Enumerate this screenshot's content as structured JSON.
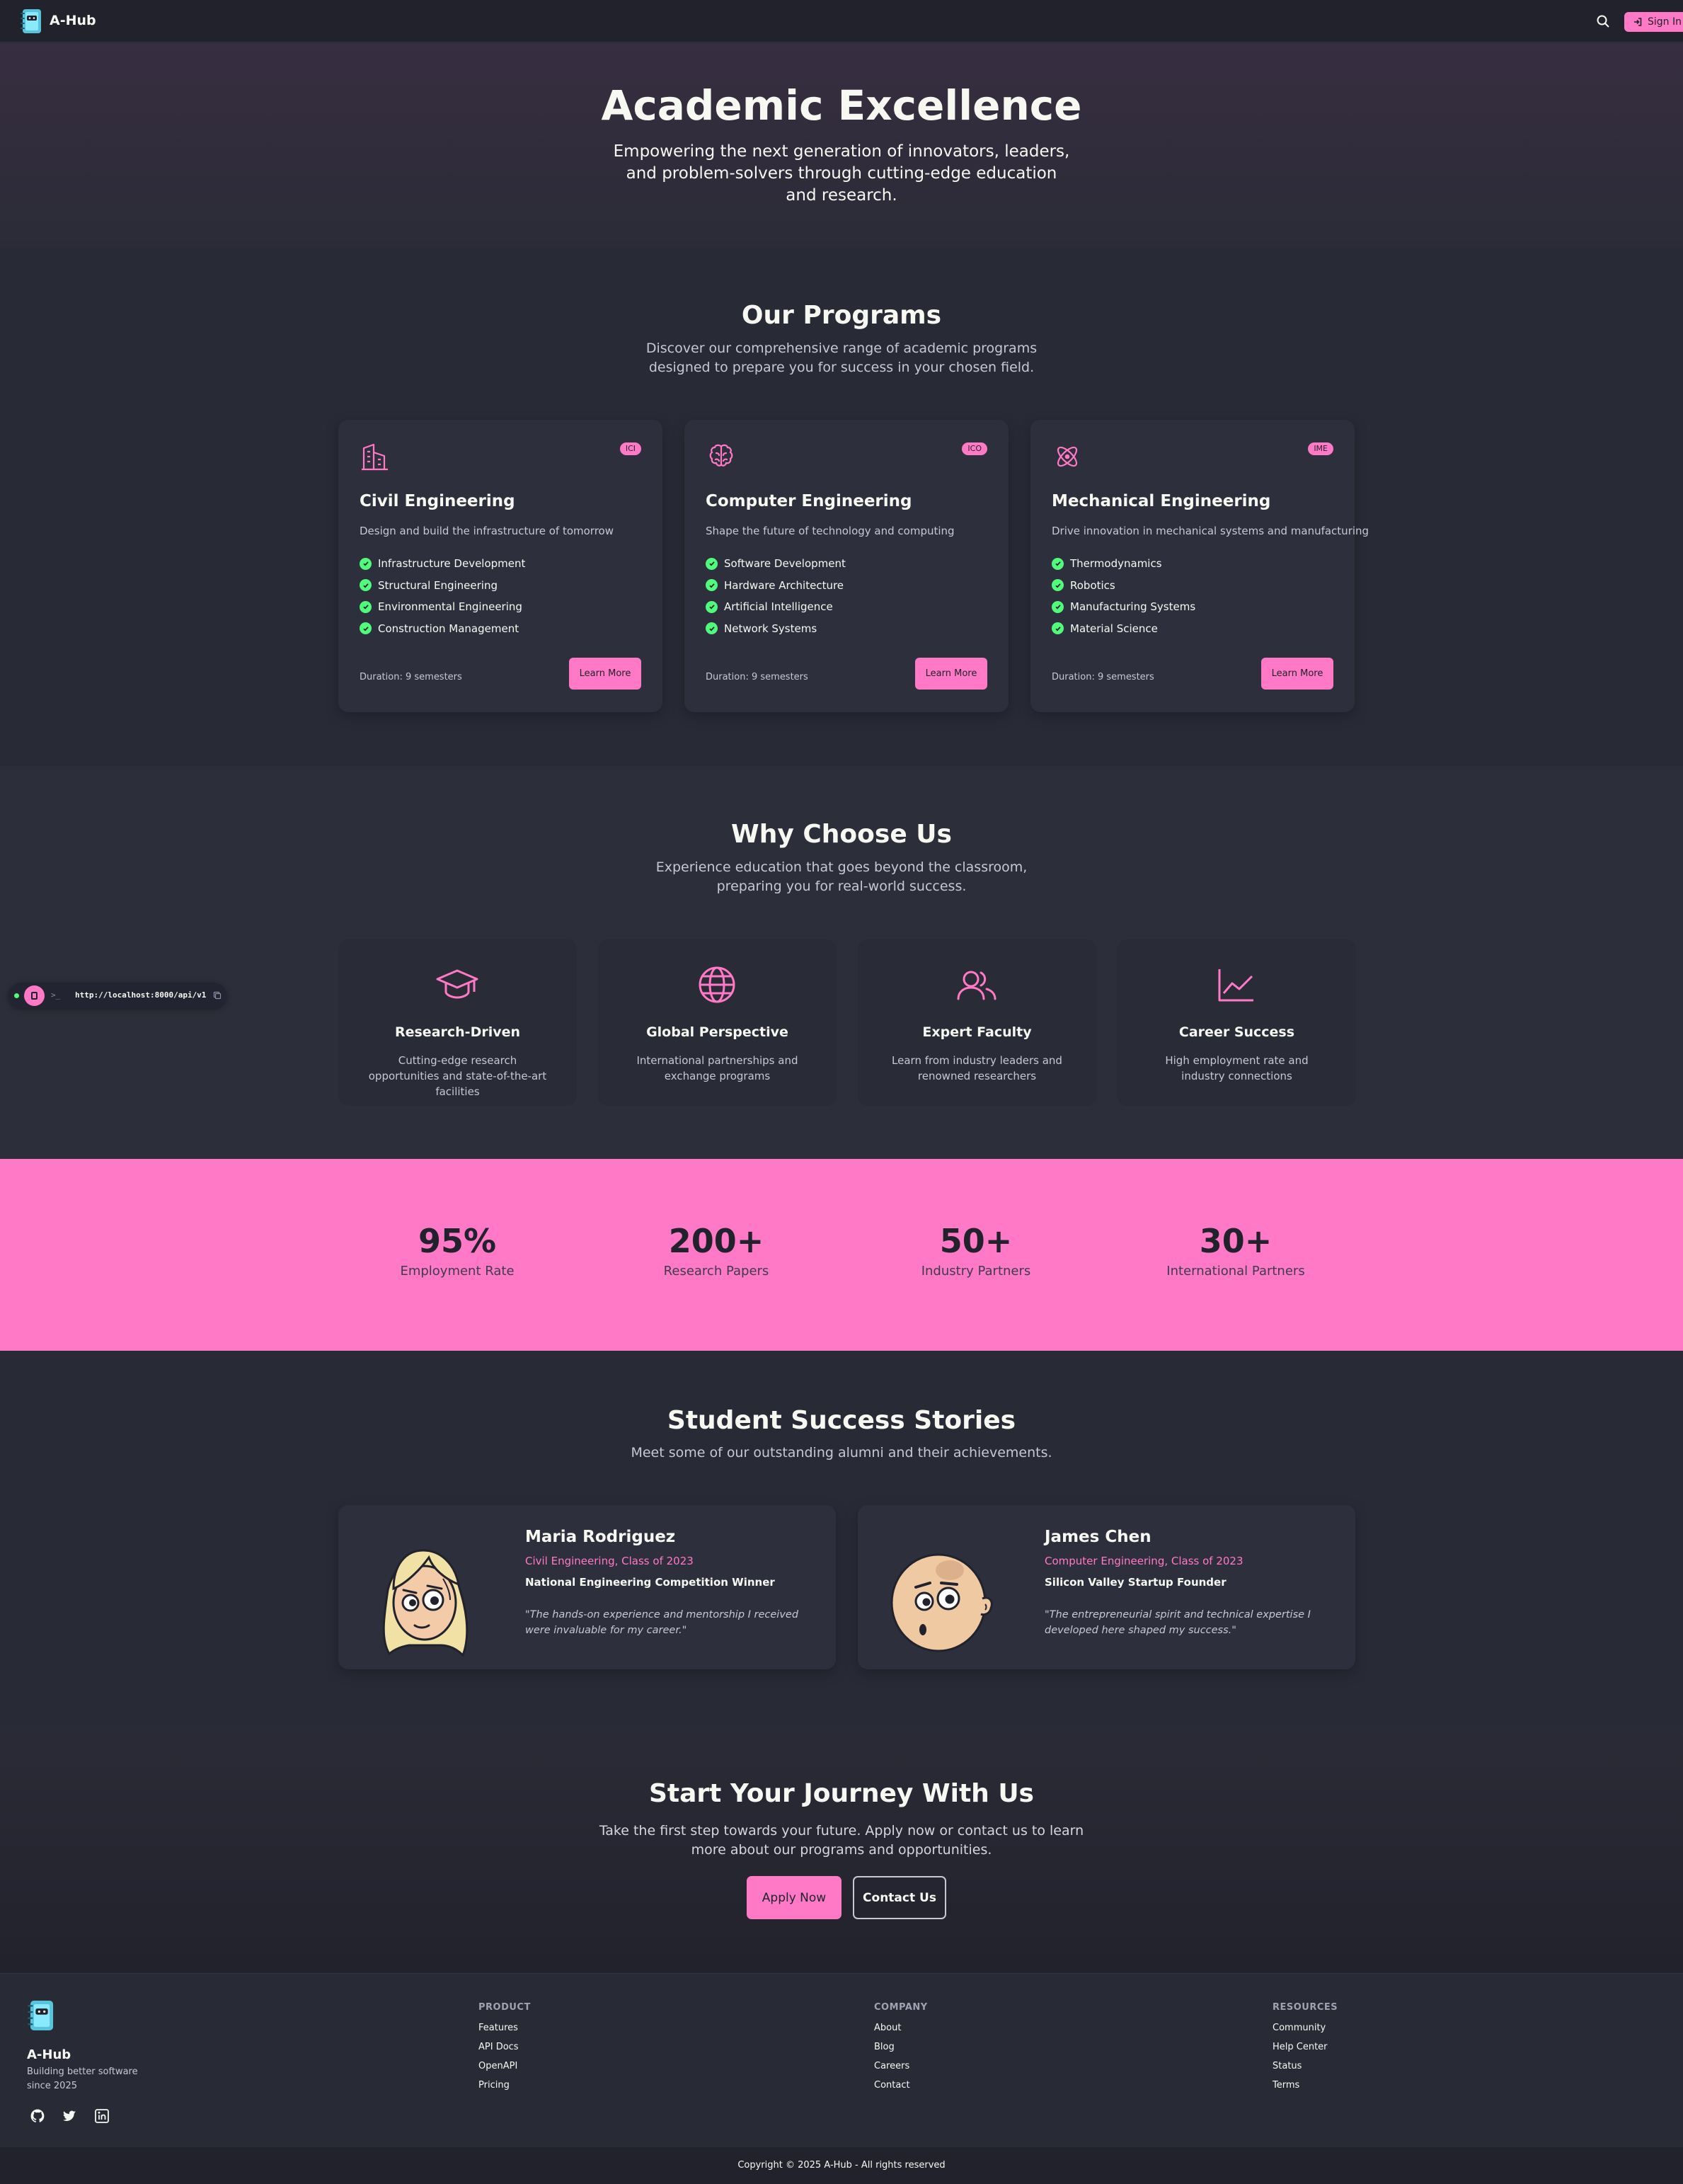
{
  "nav": {
    "brand": "A-Hub",
    "signin_label": "Sign In"
  },
  "hero": {
    "title": "Academic Excellence",
    "subtitle": "Empowering the next generation of innovators, leaders, and problem-solvers through cutting-edge education and research."
  },
  "programs": {
    "title": "Our Programs",
    "subtitle": "Discover our comprehensive range of academic programs designed to prepare you for success in your chosen field.",
    "cards": [
      {
        "icon": "building-icon",
        "badge": "ICI",
        "title": "Civil Engineering",
        "desc": "Design and build the infrastructure of tomorrow",
        "features": [
          "Infrastructure Development",
          "Structural Engineering",
          "Environmental Engineering",
          "Construction Management"
        ],
        "duration": "Duration: 9 semesters",
        "cta": "Learn More"
      },
      {
        "icon": "brain-icon",
        "badge": "ICO",
        "title": "Computer Engineering",
        "desc": "Shape the future of technology and computing",
        "features": [
          "Software Development",
          "Hardware Architecture",
          "Artificial Intelligence",
          "Network Systems"
        ],
        "duration": "Duration: 9 semesters",
        "cta": "Learn More"
      },
      {
        "icon": "atom-icon",
        "badge": "IME",
        "title": "Mechanical Engineering",
        "desc": "Drive innovation in mechanical systems and manufacturing",
        "features": [
          "Thermodynamics",
          "Robotics",
          "Manufacturing Systems",
          "Material Science"
        ],
        "duration": "Duration: 9 semesters",
        "cta": "Learn More"
      }
    ]
  },
  "why": {
    "title": "Why Choose Us",
    "subtitle": "Experience education that goes beyond the classroom, preparing you for real-world success.",
    "cards": [
      {
        "icon": "graduation-cap-icon",
        "title": "Research-Driven",
        "desc": "Cutting-edge research opportunities and state-of-the-art facilities"
      },
      {
        "icon": "globe-icon",
        "title": "Global Perspective",
        "desc": "International partnerships and exchange programs"
      },
      {
        "icon": "users-icon",
        "title": "Expert Faculty",
        "desc": "Learn from industry leaders and renowned researchers"
      },
      {
        "icon": "chart-line-icon",
        "title": "Career Success",
        "desc": "High employment rate and industry connections"
      }
    ]
  },
  "dev_widget": {
    "prompt": ">_",
    "url": "http://localhost:8000/api/v1"
  },
  "stats": [
    {
      "value": "95%",
      "label": "Employment Rate"
    },
    {
      "value": "200+",
      "label": "Research Papers"
    },
    {
      "value": "50+",
      "label": "Industry Partners"
    },
    {
      "value": "30+",
      "label": "International Partners"
    }
  ],
  "stories": {
    "title": "Student Success Stories",
    "subtitle": "Meet some of our outstanding alumni and their achievements.",
    "cards": [
      {
        "name": "Maria Rodriguez",
        "meta": "Civil Engineering, Class of 2023",
        "achievement": "National Engineering Competition Winner",
        "quote": "\"The hands-on experience and mentorship I received were invaluable for my career.\""
      },
      {
        "name": "James Chen",
        "meta": "Computer Engineering, Class of 2023",
        "achievement": "Silicon Valley Startup Founder",
        "quote": "\"The entrepreneurial spirit and technical expertise I developed here shaped my success.\""
      }
    ]
  },
  "cta": {
    "title": "Start Your Journey With Us",
    "subtitle": "Take the first step towards your future. Apply now or contact us to learn more about our programs and opportunities.",
    "apply_label": "Apply Now",
    "contact_label": "Contact Us"
  },
  "footer": {
    "brand": "A-Hub",
    "tagline": "Building better software since 2025",
    "columns": [
      {
        "heading": "PRODUCT",
        "links": [
          "Features",
          "API Docs",
          "OpenAPI",
          "Pricing"
        ]
      },
      {
        "heading": "COMPANY",
        "links": [
          "About",
          "Blog",
          "Careers",
          "Contact"
        ]
      },
      {
        "heading": "RESOURCES",
        "links": [
          "Community",
          "Help Center",
          "Status",
          "Terms"
        ]
      }
    ],
    "copyright": "Copyright © 2025 A-Hub - All rights reserved"
  },
  "colors": {
    "accent": "#ff79c6",
    "check": "#50fa7b",
    "background": "#282a36",
    "surface": "#2d2f3d"
  }
}
